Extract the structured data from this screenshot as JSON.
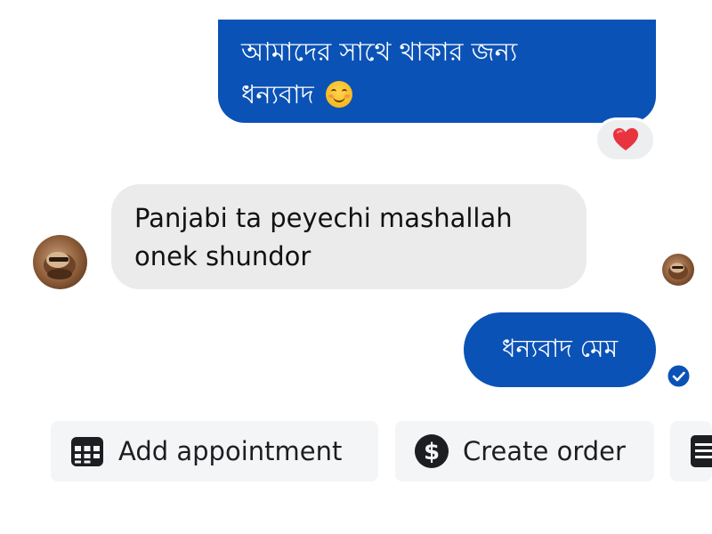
{
  "messages": {
    "outgoing_1": {
      "line_1": "আমাদের সাথে থাকার জন্য",
      "line_2": "ধন্যবাদ",
      "emoji": "smiling-face-emoji",
      "reaction": "heart-icon"
    },
    "incoming_1": {
      "line_1": "Panjabi ta peyechi mashallah",
      "line_2": "onek shundor"
    },
    "outgoing_2": {
      "text": "ধন্যবাদ মেম",
      "status": "seen-check-icon"
    }
  },
  "actions": [
    {
      "label": "Add appointment",
      "icon": "calendar-icon"
    },
    {
      "label": "Create order",
      "icon": "dollar-icon"
    },
    {
      "label": "",
      "icon": "document-icon"
    }
  ],
  "colors": {
    "outgoing_bubble": "#0b52b6",
    "incoming_bubble": "#ebebeb",
    "reaction_heart": "#e8343f",
    "chip_background": "#f4f5f7",
    "seen_check": "#0b52b6"
  }
}
